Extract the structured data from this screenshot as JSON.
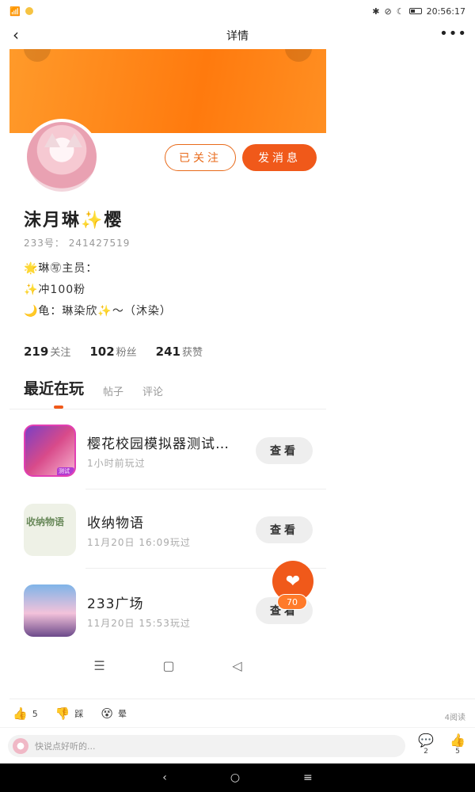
{
  "status_bar": {
    "time": "20:56:17"
  },
  "top_nav": {
    "title": "详情",
    "back_icon": "back-icon",
    "more_icon": "more-icon"
  },
  "profile": {
    "name": "沫月琳✨樱",
    "uid": "233号：  241427519",
    "follow_state_label": "已关注",
    "message_label": "发消息",
    "bio": [
      "🌟琳㊢主员：",
      "✨冲100粉",
      "🌙龟：琳染欣✨～（沐染）"
    ],
    "stats": [
      {
        "value": "219",
        "label": "关注"
      },
      {
        "value": "102",
        "label": "粉丝"
      },
      {
        "value": "241",
        "label": "获赞"
      }
    ],
    "tabs": [
      "最近在玩",
      "帖子",
      "评论"
    ],
    "active_tab": "最近在玩"
  },
  "games": [
    {
      "title": "樱花校园模拟器测试…",
      "subtitle": "1小时前玩过",
      "action": "查看",
      "badge": "测试版"
    },
    {
      "title": "收纳物语",
      "subtitle": "11月20日 16:09玩过",
      "action": "查看",
      "thumb_text": "收纳物语"
    },
    {
      "title": "233广场",
      "subtitle": "11月20日 15:53玩过",
      "action": "查看"
    }
  ],
  "fab": {
    "icon": "heart-icon",
    "count": "70"
  },
  "embedded_nav": [
    "☰",
    "▢",
    "◁"
  ],
  "post_actions": [
    {
      "icon": "thumbs-up-icon",
      "label": "5"
    },
    {
      "icon": "thumbs-down-icon",
      "label": "踩"
    },
    {
      "icon": "dizzy-face-icon",
      "label": "晕"
    }
  ],
  "read_count": "4阅读",
  "comment": {
    "placeholder": "快说点好听的..."
  },
  "bottom_icons": [
    {
      "icon": "comment-icon",
      "count": "2"
    },
    {
      "icon": "thumbs-up-icon",
      "count": "5"
    }
  ],
  "colors": {
    "accent": "#f0591a",
    "cover": "#ff8a1e"
  }
}
